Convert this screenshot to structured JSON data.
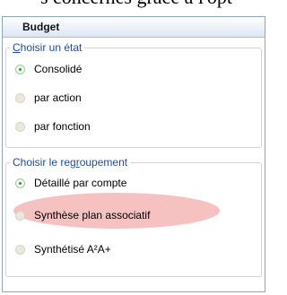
{
  "top_caption": "s concernés grâce à l'opt",
  "panel": {
    "title": "Budget"
  },
  "state_group": {
    "title_prefix": "",
    "title_underlined": "C",
    "title_rest": "hoisir un état",
    "options": [
      {
        "label": "Consolidé",
        "checked": true
      },
      {
        "label": "par action",
        "checked": false
      },
      {
        "label": "par fonction",
        "checked": false
      }
    ]
  },
  "grouping_group": {
    "title_pre": "Choisir le reg",
    "title_underlined": "r",
    "title_post": "oupement",
    "options": [
      {
        "label": "Détaillé par compte",
        "checked": true
      },
      {
        "label": "Synthèse plan associatif",
        "checked": false,
        "highlighted": true
      },
      {
        "label": "Synthétisé A²A+",
        "checked": false
      }
    ]
  },
  "colors": {
    "accent_link": "#1e4aa8",
    "radio_check": "#21a621",
    "highlight": "#f3b1b1"
  }
}
